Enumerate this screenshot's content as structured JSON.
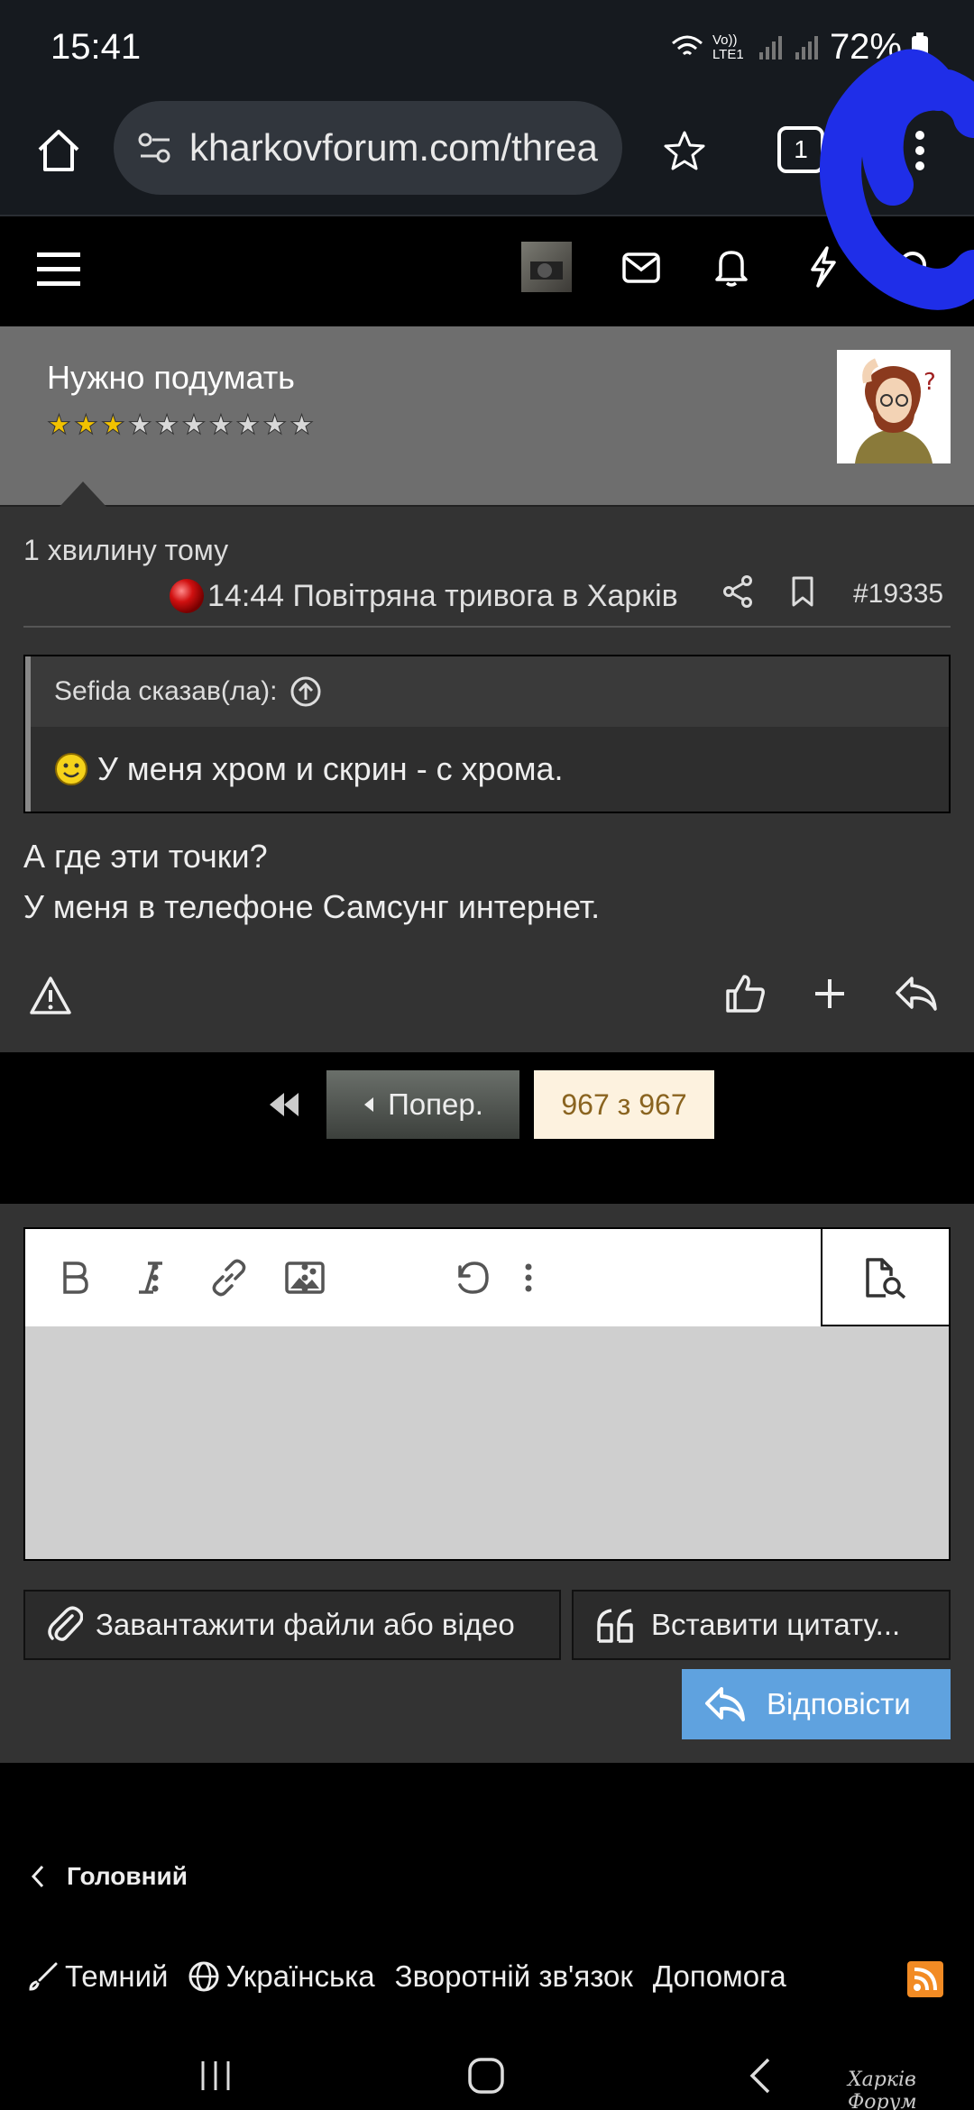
{
  "status_bar": {
    "time": "15:41",
    "network_label": "Vo)) LTE1",
    "battery": "72%"
  },
  "browser": {
    "url": "kharkovforum.com/threa",
    "tab_count": "1",
    "icons": [
      "home-icon",
      "site-settings-icon",
      "bookmark-star-icon",
      "tab-count-icon",
      "more-menu-icon"
    ]
  },
  "forum_nav": {
    "icons": [
      "menu-icon",
      "user-avatar",
      "mail-icon",
      "bell-icon",
      "lightning-icon",
      "search-icon"
    ]
  },
  "member": {
    "title": "Нужно подумать",
    "stars_filled": 3,
    "stars_total": 10
  },
  "post": {
    "time_ago": "1 хвилину тому",
    "alert": "14:44 Повітряна тривога в Харків",
    "number": "#19335",
    "quote": {
      "author": "Sefida сказав(ла):",
      "text": "У меня хром и скрин - с хрома."
    },
    "body": [
      "А где эти точки?",
      "У меня в телефоне Самсунг интернет."
    ]
  },
  "pager": {
    "prev_label": "Попер.",
    "current": "967 з 967"
  },
  "editor": {
    "toolbar_icons": [
      "bold-icon",
      "italic-icon",
      "more-vertical-icon",
      "link-icon",
      "image-icon",
      "more-vertical-icon",
      "undo-icon",
      "more-vertical-icon",
      "preview-icon"
    ],
    "upload_label": "Завантажити файли або відео",
    "insert_quote_label": "Вставити цитату...",
    "reply_label": "Відповісти"
  },
  "footer": {
    "breadcrumb": "Головний",
    "links": [
      "Темний",
      "Українська",
      "Зворотній зв'язок",
      "Допомога"
    ],
    "watermark": "Харків Форум"
  },
  "colors": {
    "annotation_stroke": "#1f2ee8",
    "reply_button": "#5fa2df",
    "pager_current_bg": "#fdf2df"
  }
}
